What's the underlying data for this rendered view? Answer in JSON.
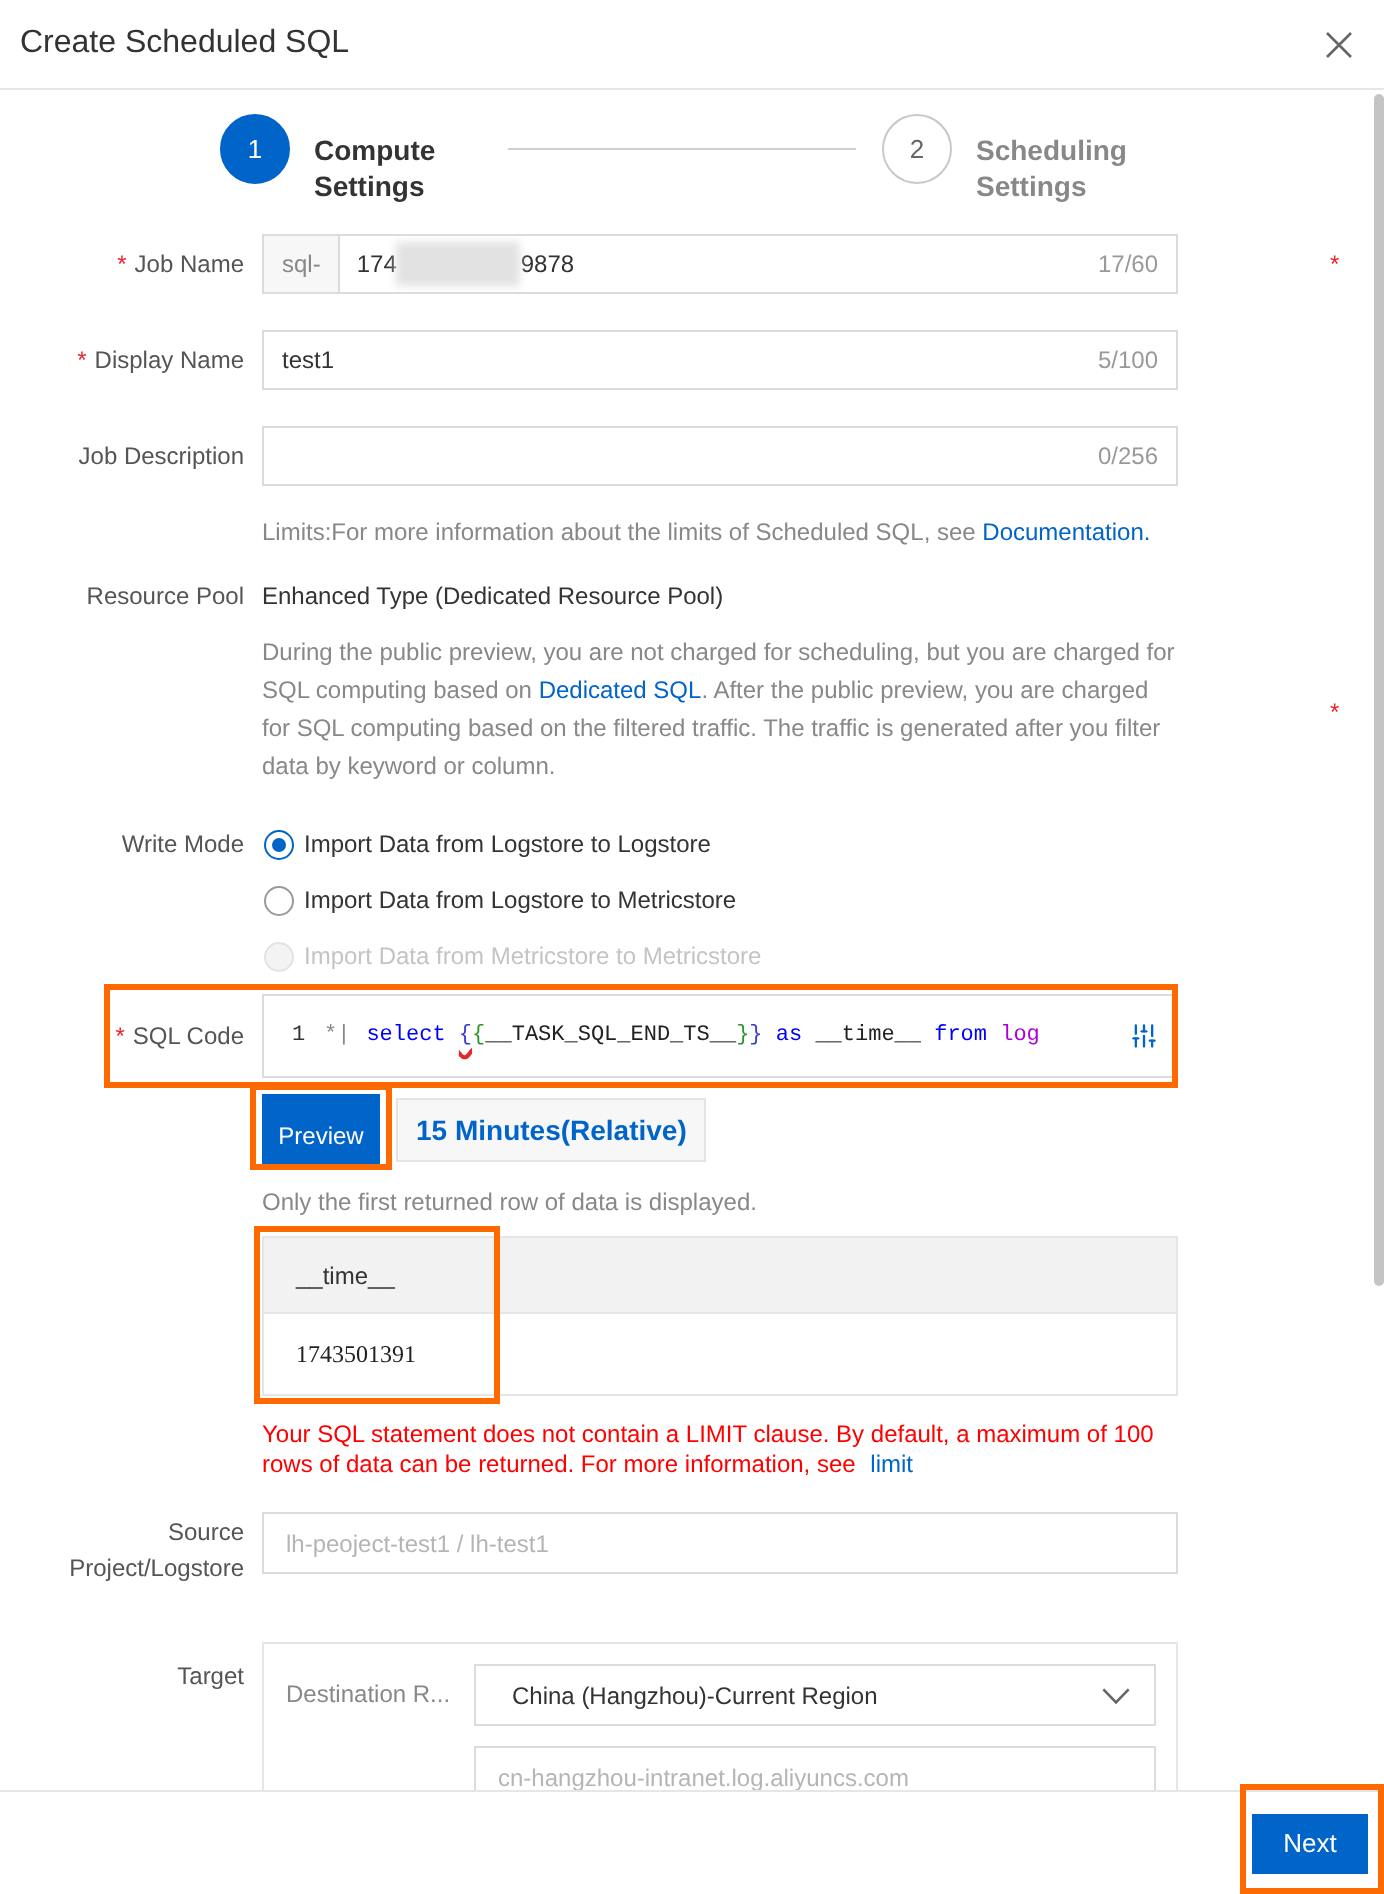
{
  "dialog": {
    "title": "Create Scheduled SQL"
  },
  "steps": [
    {
      "number": "1",
      "label": "Compute Settings",
      "selected": true
    },
    {
      "number": "2",
      "label": "Scheduling Settings",
      "selected": false
    }
  ],
  "form": {
    "job_name": {
      "required_mark": "*",
      "label": "Job Name",
      "prefix": "sql-",
      "value_start": "174",
      "redacted": true,
      "value_end": "9878",
      "counter": "17/60",
      "side_mark": "*"
    },
    "display_name": {
      "required_mark": "*",
      "label": "Display Name",
      "value": "test1",
      "counter": "5/100"
    },
    "job_description": {
      "label": "Job Description",
      "counter": "0/256"
    },
    "limits_note": {
      "text": "Limits:For more information about the limits of Scheduled SQL, see ",
      "link": "Documentation."
    },
    "resource_pool": {
      "label": "Resource Pool",
      "value": "Enhanced Type (Dedicated Resource Pool)",
      "description": {
        "before": "During the public preview, you are not charged for scheduling, but you are charged for SQL computing based on ",
        "link": "Dedicated SQL",
        "after": ". After the public preview, you are charged for SQL computing based on the filtered traffic. The traffic is generated after you filter data by keyword or column."
      },
      "side_mark": "*"
    },
    "write_mode": {
      "label": "Write Mode",
      "options": [
        {
          "label": "Import Data from Logstore to Logstore",
          "selected": true,
          "disabled": false
        },
        {
          "label": "Import Data from Logstore to Metricstore",
          "selected": false,
          "disabled": false
        },
        {
          "label": "Import Data from Metricstore to Metricstore",
          "selected": false,
          "disabled": true
        }
      ]
    },
    "sql_code": {
      "required_mark": "*",
      "label": "SQL Code",
      "line_number": "1",
      "prompt": "*|",
      "tokens": [
        {
          "text": "select ",
          "kind": "keyword",
          "error": false
        },
        {
          "text": "{",
          "kind": "bracket1",
          "error": true
        },
        {
          "text": "{",
          "kind": "bracket2",
          "error": false
        },
        {
          "text": "__TASK_SQL_END_TS__",
          "kind": "ident",
          "error": false
        },
        {
          "text": "}",
          "kind": "bracket2",
          "error": false
        },
        {
          "text": "}",
          "kind": "bracket1",
          "error": false
        },
        {
          "text": " as ",
          "kind": "keyword",
          "error": false
        },
        {
          "text": "__time__",
          "kind": "ident",
          "error": false
        },
        {
          "text": " from ",
          "kind": "keyword",
          "error": false
        },
        {
          "text": "log",
          "kind": "table",
          "error": false
        }
      ],
      "highlighted": true
    },
    "preview": {
      "buttons": [
        {
          "label": "Preview",
          "kind": "primary",
          "highlighted": true
        },
        {
          "label": "15 Minutes(Relative)",
          "kind": "time_range",
          "highlighted": false
        }
      ],
      "note": "Only the first returned row of data is displayed.",
      "table": {
        "columns": [
          {
            "label": "__time__"
          }
        ],
        "rows": [
          [
            "1743501391"
          ]
        ],
        "highlighted": true
      },
      "warning": {
        "text": "Your SQL statement does not contain a LIMIT clause. By default, a maximum of 100 rows of data can be returned. For more information, see ",
        "link": "limit"
      }
    },
    "source": {
      "label": "Source Project/Logstore",
      "value": "lh-peoject-test1 / lh-test1",
      "disabled": true
    },
    "target": {
      "label": "Target",
      "destination_label": "Destination R...",
      "region": "China (Hangzhou)-Current Region",
      "endpoint": {
        "value": "cn-hangzhou-intranet.log.aliyuncs.com",
        "disabled": true
      }
    }
  },
  "footer": {
    "next_button": {
      "label": "Next",
      "highlighted": true
    }
  }
}
